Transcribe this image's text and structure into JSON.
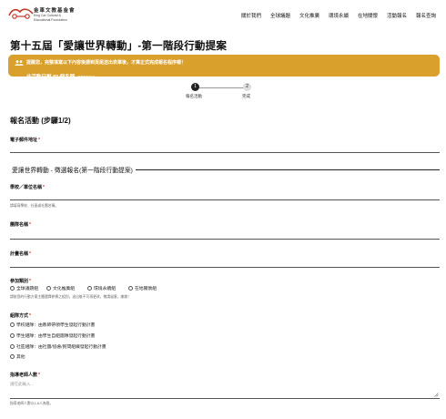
{
  "header": {
    "brand_cn": "金車文教基金會",
    "brand_en_1": "King Car Cultural &",
    "brand_en_2": "Educational Foundation",
    "nav": [
      "關於我們",
      "全球議題",
      "文化推廣",
      "環境永續",
      "在地關懷",
      "活動報名",
      "報名查詢"
    ]
  },
  "page": {
    "title": "第十五屆「愛讓世界轉動」-第一階段行動提案"
  },
  "banner": {
    "line1": "提醒您，完整填寫以下內容後請到頁尾送出表單後，才算正式完成報名程序喔！",
    "line2": "此活動只剩 89 個名額",
    "line2_small": "(名額機制參考)",
    "icon": "users-icon"
  },
  "stepper": {
    "step1_num": "1",
    "step1_label": "報名活動",
    "step2_num": "2",
    "step2_label": "完成"
  },
  "form": {
    "section_title": "報名活動 (步驟1/2)",
    "email_label": "電子郵件地址",
    "group_heading": "愛讓世界轉動 - 徵選報名(第一階段行動提案)",
    "school_label": "學校／單位名稱",
    "school_help": "請填寫學校、社區或社團名稱。",
    "team_label": "團隊名稱",
    "plan_label": "計畫名稱",
    "category_label": "參加類別",
    "category_options": [
      "全球議題組",
      "文化推廣組",
      "環境永續組",
      "在地關懷組"
    ],
    "category_help": "請依您的行動方案主體選擇參賽之組別，送出後不可再更改，敬請留意，謝謝！",
    "type_label": "組隊方式",
    "type_options": [
      "學校組隊：由教師帶領學生發起行動計畫",
      "學生組隊：由學生自組團隊發起行動計畫",
      "社區組隊：由社團/協會/民間組織發起行動計畫",
      "其他"
    ],
    "teacher_label": "指導老師人數",
    "teacher_placeholder": "請在此輸入...",
    "teacher_help": "指導老師人數以1-6人為限。",
    "required_mark": "*"
  },
  "colors": {
    "banner_bg": "#d9a02c",
    "required": "#c0392b"
  }
}
